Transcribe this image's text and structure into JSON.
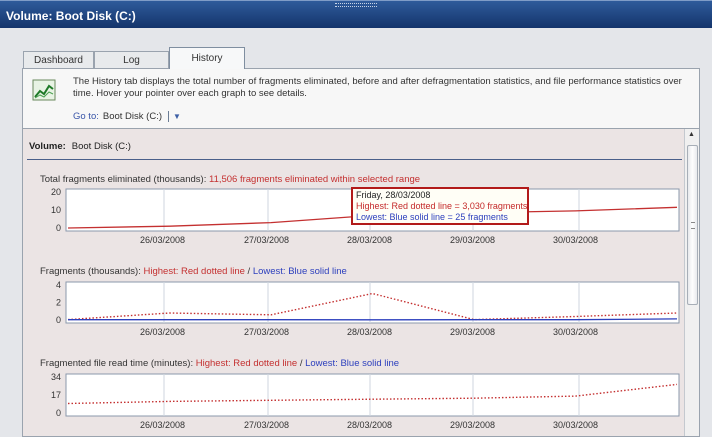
{
  "window": {
    "title": "Volume: Boot Disk (C:)"
  },
  "tabs": [
    {
      "label": "Dashboard",
      "active": false
    },
    {
      "label": "Log",
      "active": false
    },
    {
      "label": "History",
      "active": true
    }
  ],
  "info": {
    "icon": "line-chart-icon",
    "description": "The History tab displays the total number of fragments eliminated, before and after defragmentation statistics, and file performance statistics over time. Hover your pointer over each graph to see details.",
    "goto_label": "Go to:",
    "goto_value": "Boot Disk (C:)"
  },
  "volume": {
    "label": "Volume:",
    "value": "Boot Disk (C:)"
  },
  "colors": {
    "highest": "#c43030",
    "lowest": "#2c3fbd",
    "titlebar": "#1c3f7a"
  },
  "graphs": [
    {
      "title": "Total fragments eliminated (thousands):",
      "subtitle": "11,506 fragments eliminated within selected range",
      "yticks": [
        "20",
        "10",
        "0"
      ],
      "xticks": [
        "26/03/2008",
        "27/03/2008",
        "28/03/2008",
        "29/03/2008",
        "30/03/2008"
      ]
    },
    {
      "title": "Fragments (thousands):",
      "highest_label": "Highest: Red dotted line",
      "sep": "/",
      "lowest_label": "Lowest: Blue solid line",
      "yticks": [
        "4",
        "2",
        "0"
      ],
      "xticks": [
        "26/03/2008",
        "27/03/2008",
        "28/03/2008",
        "29/03/2008",
        "30/03/2008"
      ]
    },
    {
      "title": "Fragmented file read time (minutes):",
      "highest_label": "Highest: Red dotted line",
      "sep": "/",
      "lowest_label": "Lowest: Blue solid line",
      "yticks": [
        "34",
        "17",
        "0"
      ],
      "xticks": [
        "26/03/2008",
        "27/03/2008",
        "28/03/2008",
        "29/03/2008",
        "30/03/2008"
      ]
    }
  ],
  "tooltip": {
    "date": "Friday, 28/03/2008",
    "highest": "Highest: Red dotted line = 3,030 fragments",
    "lowest": "Lowest: Blue solid line = 25 fragments"
  },
  "chart_data": [
    {
      "type": "line",
      "title": "Total fragments eliminated (thousands):",
      "xlabel": "",
      "ylabel": "",
      "ylim": [
        0,
        20
      ],
      "x": [
        0,
        1,
        2,
        3,
        4,
        5,
        6
      ],
      "series": [
        {
          "values": [
            0,
            1,
            3,
            7,
            8.5,
            9.5,
            11.5
          ],
          "style": "solid",
          "color": "#c43030"
        }
      ]
    },
    {
      "type": "line",
      "title": "Fragments (thousands):",
      "xlabel": "",
      "ylabel": "",
      "ylim": [
        0,
        4
      ],
      "x": [
        0,
        1,
        2,
        3,
        4,
        5,
        6
      ],
      "series": [
        {
          "name": "Highest: Red dotted line",
          "values": [
            0.05,
            0.8,
            0.6,
            3.03,
            0.05,
            0.4,
            0.8
          ],
          "style": "dotted",
          "color": "#c43030"
        },
        {
          "name": "Lowest: Blue solid line",
          "values": [
            0.03,
            0.03,
            0.03,
            0.025,
            0.03,
            0.03,
            0.12
          ],
          "style": "solid",
          "color": "#2c3fbd"
        }
      ]
    },
    {
      "type": "line",
      "title": "Fragmented file read time (minutes):",
      "xlabel": "",
      "ylabel": "",
      "ylim": [
        0,
        34
      ],
      "x": [
        0,
        1,
        2,
        3,
        4,
        5,
        6
      ],
      "series": [
        {
          "name": "Highest: Red dotted line",
          "values": [
            9,
            11,
            12,
            13,
            14,
            16,
            27
          ],
          "style": "dotted",
          "color": "#c43030"
        }
      ]
    }
  ]
}
